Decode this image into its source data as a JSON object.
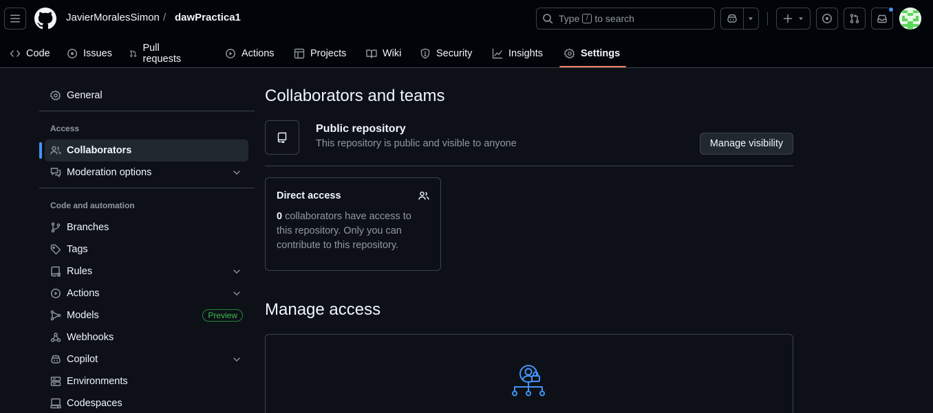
{
  "header": {
    "owner": "JavierMoralesSimon",
    "separator": "/",
    "repo": "dawPractica1",
    "search": {
      "prefix": "Type",
      "key": "/",
      "suffix": "to search"
    }
  },
  "repo_nav": {
    "tabs": [
      {
        "label": "Code",
        "icon": "code-icon"
      },
      {
        "label": "Issues",
        "icon": "issue-opened-icon"
      },
      {
        "label": "Pull requests",
        "icon": "git-pull-request-icon"
      },
      {
        "label": "Actions",
        "icon": "play-icon"
      },
      {
        "label": "Projects",
        "icon": "table-icon"
      },
      {
        "label": "Wiki",
        "icon": "book-icon"
      },
      {
        "label": "Security",
        "icon": "shield-icon"
      },
      {
        "label": "Insights",
        "icon": "graph-icon"
      },
      {
        "label": "Settings",
        "icon": "gear-icon",
        "active": true
      }
    ]
  },
  "sidebar": {
    "general": "General",
    "access_heading": "Access",
    "collaborators": "Collaborators",
    "moderation": "Moderation options",
    "code_heading": "Code and automation",
    "branches": "Branches",
    "tags": "Tags",
    "rules": "Rules",
    "actions": "Actions",
    "models": "Models",
    "models_badge": "Preview",
    "webhooks": "Webhooks",
    "copilot": "Copilot",
    "environments": "Environments",
    "codespaces": "Codespaces"
  },
  "main": {
    "title": "Collaborators and teams",
    "visibility": {
      "title": "Public repository",
      "description": "This repository is public and visible to anyone",
      "button": "Manage visibility"
    },
    "direct_access": {
      "title": "Direct access",
      "count": "0",
      "description": " collaborators have access to this repository. Only you can contribute to this repository."
    },
    "manage_access_title": "Manage access"
  },
  "colors": {
    "background": "#0d1117",
    "header_bg": "#010409",
    "accent_blue": "#4493f8",
    "active_tab_underline": "#f78166",
    "preview_green": "#3fb950"
  }
}
